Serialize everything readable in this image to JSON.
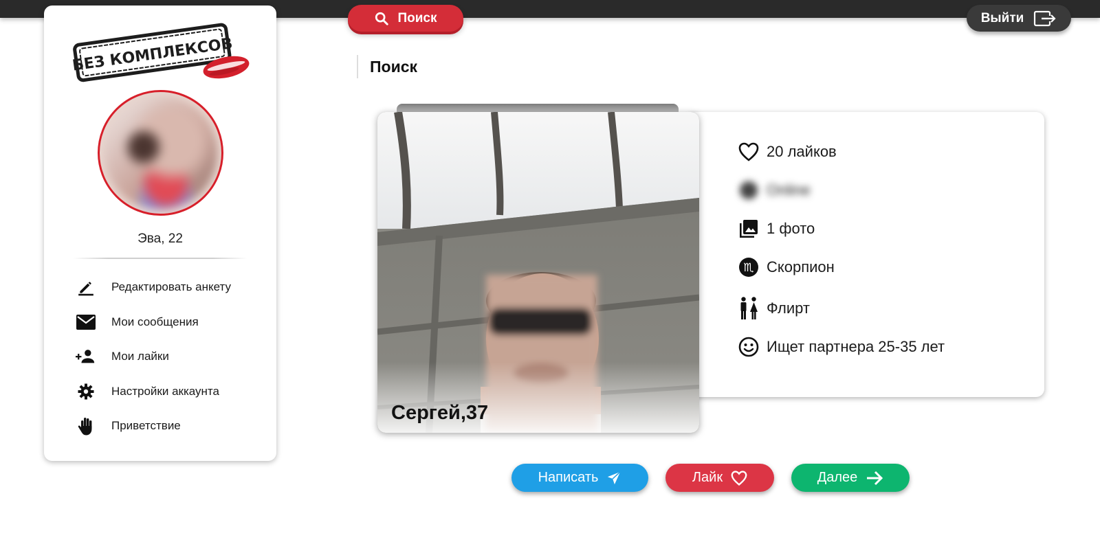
{
  "app": {
    "logo_text": "БЕЗ КОМПЛЕКСОВ"
  },
  "header": {
    "search_label": "Поиск",
    "logout_label": "Выйти"
  },
  "sidebar": {
    "user_name": "Эва, 22",
    "items": [
      {
        "label": "Редактировать анкету",
        "icon": "edit-icon"
      },
      {
        "label": "Мои сообщения",
        "icon": "mail-icon"
      },
      {
        "label": "Мои лайки",
        "icon": "add-person-icon"
      },
      {
        "label": "Настройки аккаунта",
        "icon": "gear-icon"
      },
      {
        "label": "Приветствие",
        "icon": "hand-icon"
      }
    ]
  },
  "main": {
    "title": "Поиск",
    "profile": {
      "name": "Сергей,37",
      "likes": "20 лайков",
      "status": "Online",
      "photos": "1 фото",
      "zodiac": "Скорпион",
      "goal": "Флирт",
      "seeking": "Ищет партнера 25-35 лет"
    }
  },
  "actions": {
    "write_label": "Написать",
    "like_label": "Лайк",
    "next_label": "Далее"
  },
  "colors": {
    "brand_red": "#d42d38",
    "write_blue": "#1f9fe6",
    "like_red": "#dc3545",
    "next_green": "#0db56f",
    "topbar": "#2a2a2a"
  }
}
